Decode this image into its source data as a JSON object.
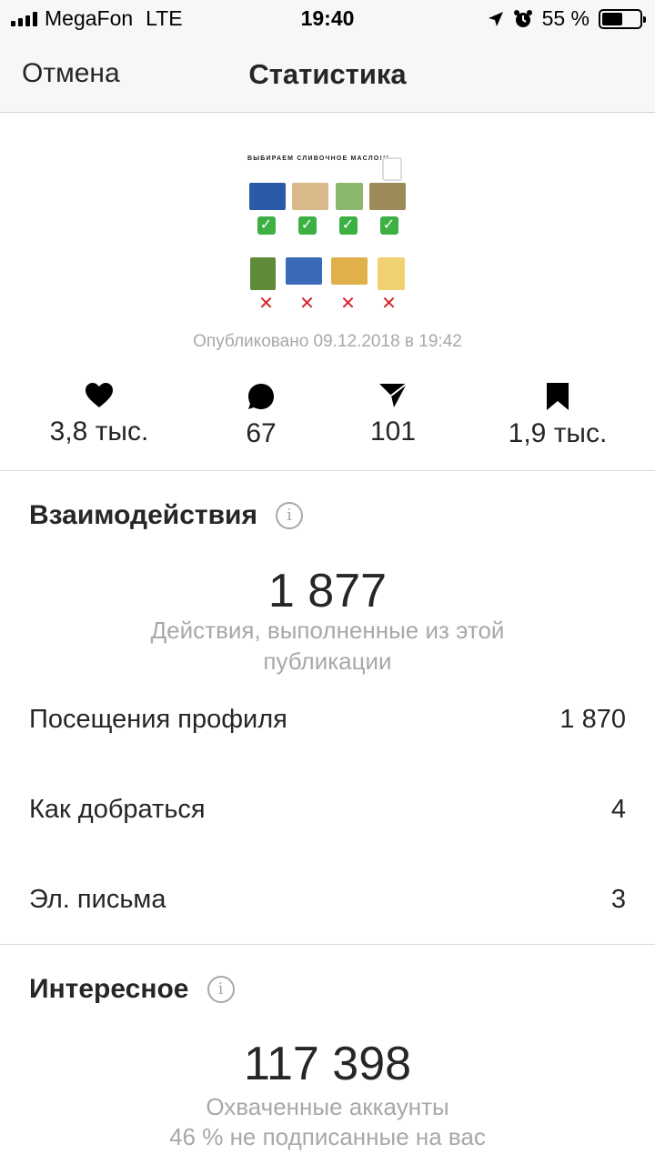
{
  "status_bar": {
    "carrier": "MegaFon",
    "network": "LTE",
    "time": "19:40",
    "battery_percent": "55 %",
    "battery_level": 0.55
  },
  "nav": {
    "cancel_label": "Отмена",
    "title": "Статистика"
  },
  "post": {
    "image_caption": "ВЫБИРАЕМ СЛИВОЧНОЕ МАСЛО!!!",
    "published": "Опубликовано 09.12.2018 в 19:42"
  },
  "stats": {
    "likes": "3,8 тыс.",
    "comments": "67",
    "shares": "101",
    "saves": "1,9 тыс."
  },
  "interactions": {
    "title": "Взаимодействия",
    "total": "1 877",
    "description": "Действия, выполненные из этой публикации",
    "rows": [
      {
        "label": "Посещения профиля",
        "value": "1 870"
      },
      {
        "label": "Как добраться",
        "value": "4"
      },
      {
        "label": "Эл. письма",
        "value": "3"
      }
    ]
  },
  "discovery": {
    "title": "Интересное",
    "total": "117 398",
    "line1": "Охваченные аккаунты",
    "line2": "46 % не подписанные на вас"
  },
  "colors": {
    "check": "#3cb043",
    "cross": "#d9212c",
    "secondary_text": "#a8a8a8"
  }
}
